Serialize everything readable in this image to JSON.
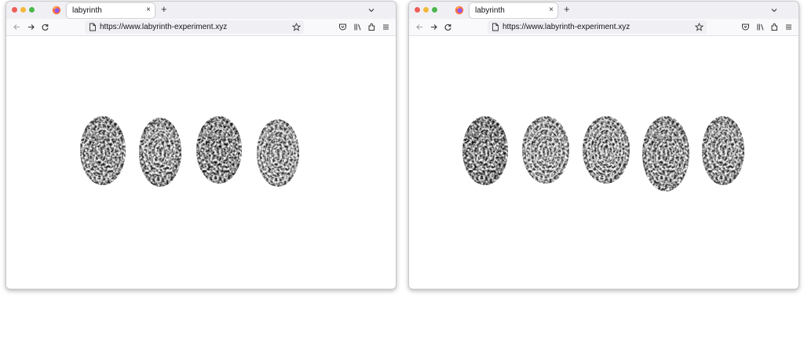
{
  "colors": {
    "close": "#ee5e56",
    "minimize": "#f2b93b",
    "maximize": "#4bb64c",
    "ink": "#111111"
  },
  "windows": [
    {
      "tab": {
        "label": "labyrinth"
      },
      "url": "https://www.labyrinth-experiment.xyz",
      "fingerprint_count": 4
    },
    {
      "tab": {
        "label": "labyrinth"
      },
      "url": "https://www.labyrinth-experiment.xyz",
      "fingerprint_count": 5
    }
  ],
  "icons": {
    "close_tab": "×",
    "new_tab": "+"
  }
}
